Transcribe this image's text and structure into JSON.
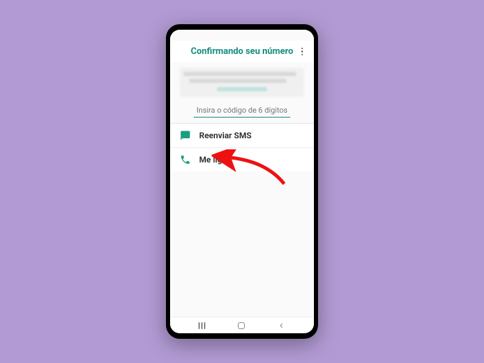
{
  "header": {
    "title": "Confirmando seu número"
  },
  "input": {
    "placeholder": "Insira o código de 6 dígitos"
  },
  "options": {
    "resend": "Reenviar SMS",
    "call": "Me ligue"
  }
}
